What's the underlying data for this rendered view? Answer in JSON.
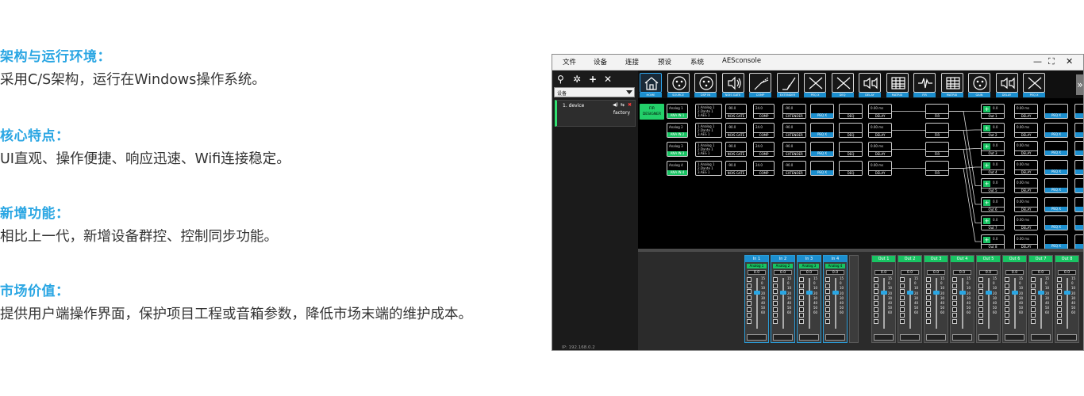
{
  "sections": [
    {
      "title": "架构与运行环境：",
      "body": "采用C/S架构，运行在Windows操作系统。"
    },
    {
      "title": "核心特点：",
      "body": "UI直观、操作便捷、响应迅速、Wifi连接稳定。"
    },
    {
      "title": "新增功能：",
      "body": "相比上一代，新增设备群控、控制同步功能。"
    },
    {
      "title": "市场价值：",
      "body": "提供用户端操作界面，保护项目工程或音箱参数，降低市场末端的维护成本。"
    }
  ],
  "app": {
    "menu": [
      "文件",
      "设备",
      "连接",
      "预设",
      "系统",
      "AESconsole"
    ],
    "window_controls": {
      "minimize": "—",
      "maximize": "⛶",
      "close": "✕"
    },
    "left_tools": {
      "search": "⚲",
      "settings": "✲",
      "add": "+",
      "remove": "✕"
    },
    "device_dropdown": "设备",
    "device_card": {
      "name": "1. device",
      "preset": "factory",
      "icons": [
        "◀)",
        "⇆",
        "✖"
      ]
    },
    "ip": "IP: 192.168.0.2",
    "toolbar": [
      "HOME",
      "SOURCE",
      "DSP IN",
      "NOIS GATE",
      "COMP",
      "EXTENDER",
      "PEQ X",
      "DEQ",
      "DELAY",
      "MATRIX",
      "FIR",
      "MATRIX",
      "GAIN",
      "DELAY",
      "PEQ X"
    ],
    "fir_button": "FIR DESIGNER",
    "input_rows": [
      {
        "source": "Analog 1",
        "tag": "ANA IN 1"
      },
      {
        "source": "Analog 2",
        "tag": "ANA IN 2"
      },
      {
        "source": "Analog 3",
        "tag": "ANA IN 3"
      },
      {
        "source": "Analog 4",
        "tag": "ANA IN 4"
      }
    ],
    "dsp_in_lines": [
      "1.Analog 1",
      "2.Dante 1",
      "3.AES 1"
    ],
    "block_labels": {
      "gate": "NOIS GATE",
      "comp": "COMP",
      "ext": "EXTENDER",
      "peq": "PEQ X",
      "deq": "DEQ",
      "delay": "DELAY",
      "fir": "FIR",
      "gain": "GAIN"
    },
    "gate_val": "-90.0",
    "comp_val": "24.0",
    "ext_val": "-90.0",
    "delay_val": "0.00 ms",
    "gain_val": "0.0",
    "outputs": [
      "Out 1",
      "Out 2",
      "Out 3",
      "Out 4",
      "Out 5",
      "Out 6",
      "Out 7",
      "Out 8"
    ],
    "fader_inputs": [
      {
        "name": "In 1",
        "source": "Analog 1",
        "value": "0.0"
      },
      {
        "name": "In 2",
        "source": "Analog 2",
        "value": "0.0"
      },
      {
        "name": "In 3",
        "source": "Analog 3",
        "value": "0.0"
      },
      {
        "name": "In 4",
        "source": "Analog 4",
        "value": "0.0"
      }
    ],
    "fader_outputs": [
      {
        "name": "Out 1",
        "value": "0.0"
      },
      {
        "name": "Out 2",
        "value": "0.0"
      },
      {
        "name": "Out 3",
        "value": "0.0"
      },
      {
        "name": "Out 4",
        "value": "0.0"
      },
      {
        "name": "Out 5",
        "value": "0.0"
      },
      {
        "name": "Out 6",
        "value": "0.0"
      },
      {
        "name": "Out 7",
        "value": "0.0"
      },
      {
        "name": "Out 8",
        "value": "0.0"
      }
    ],
    "fader_scale": [
      "15",
      "0",
      "10",
      "20",
      "30",
      "40",
      "50",
      "60"
    ]
  },
  "colors": {
    "heading": "#2aa6e3",
    "body": "#333333",
    "green": "#18c463",
    "blue": "#1c8fcf"
  }
}
